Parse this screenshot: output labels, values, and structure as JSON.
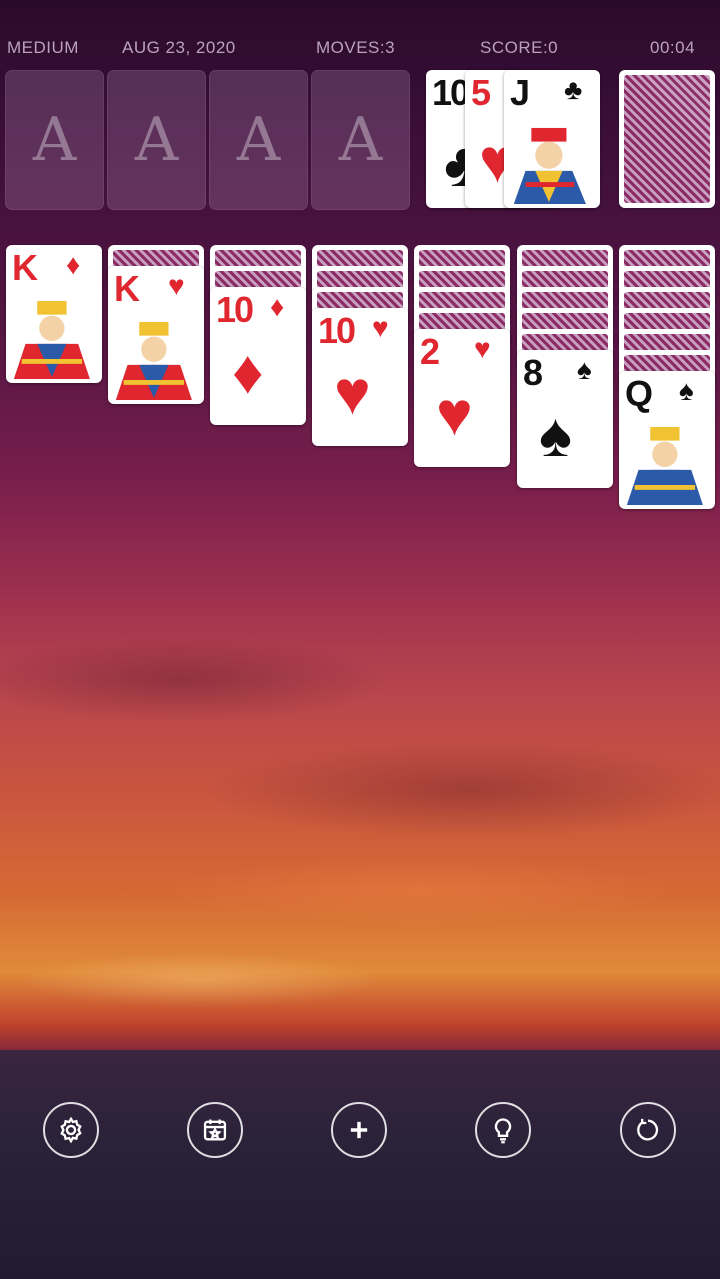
{
  "status": {
    "difficulty": "MEDIUM",
    "date": "AUG 23, 2020",
    "moves": "MOVES:3",
    "score": "SCORE:0",
    "timer": "00:04"
  },
  "foundations": [
    {
      "label": "A"
    },
    {
      "label": "A"
    },
    {
      "label": "A"
    },
    {
      "label": "A"
    }
  ],
  "waste": [
    {
      "rank": "10",
      "suit": "♣",
      "color": "black"
    },
    {
      "rank": "5",
      "suit": "♥",
      "color": "red"
    },
    {
      "rank": "J",
      "suit": "♣",
      "color": "black"
    }
  ],
  "tableau": [
    {
      "hidden": 0,
      "rank": "K",
      "suit": "♦",
      "color": "red"
    },
    {
      "hidden": 1,
      "rank": "K",
      "suit": "♥",
      "color": "red"
    },
    {
      "hidden": 2,
      "rank": "10",
      "suit": "♦",
      "color": "red"
    },
    {
      "hidden": 3,
      "rank": "10",
      "suit": "♥",
      "color": "red"
    },
    {
      "hidden": 4,
      "rank": "2",
      "suit": "♥",
      "color": "red"
    },
    {
      "hidden": 5,
      "rank": "8",
      "suit": "♠",
      "color": "black"
    },
    {
      "hidden": 6,
      "rank": "Q",
      "suit": "♠",
      "color": "black"
    }
  ],
  "toolbar": [
    "settings-icon",
    "daily-challenge-icon",
    "new-game-icon",
    "hint-icon",
    "undo-icon"
  ]
}
